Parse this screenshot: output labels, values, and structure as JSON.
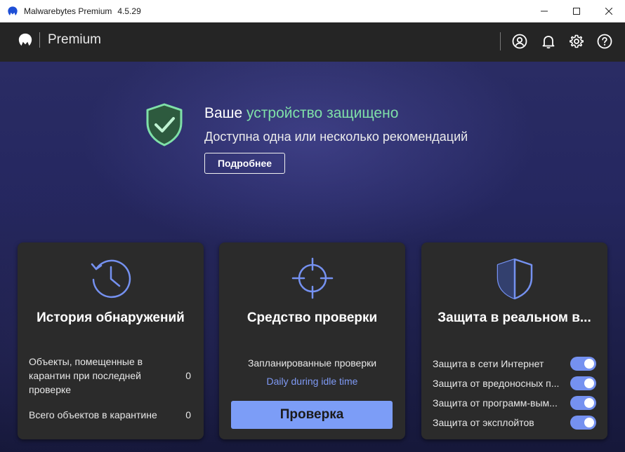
{
  "window": {
    "title": "Malwarebytes Premium",
    "version": "4.5.29"
  },
  "header": {
    "product": "Premium"
  },
  "status": {
    "prefix": "Ваше ",
    "highlight": "устройство защищено",
    "subtitle": "Доступна одна или несколько рекомендаций",
    "details_button": "Подробнее",
    "accent_color": "#7fe0a8"
  },
  "cards": {
    "history": {
      "title": "История обнаружений",
      "rows": [
        {
          "label": "Объекты, помещенные в карантин при последней проверке",
          "value": "0"
        },
        {
          "label": "Всего объектов в карантине",
          "value": "0"
        }
      ]
    },
    "scanner": {
      "title": "Средство проверки",
      "schedule_label": "Запланированные проверки",
      "schedule_value": "Daily during idle time",
      "scan_button": "Проверка"
    },
    "realtime": {
      "title": "Защита в реальном в...",
      "items": [
        {
          "label": "Защита в сети Интернет",
          "enabled": true
        },
        {
          "label": "Защита от вредоносных п...",
          "enabled": true
        },
        {
          "label": "Защита от программ-вым...",
          "enabled": true
        },
        {
          "label": "Защита от эксплойтов",
          "enabled": true
        }
      ]
    }
  },
  "colors": {
    "accent_blue": "#7c9df7",
    "icon_blue": "#7591f0",
    "card_bg": "#2b2b2b"
  },
  "icons": [
    "malwarebytes-logo",
    "account-icon",
    "bell-icon",
    "gear-icon",
    "help-icon",
    "shield-check-icon",
    "history-clock-icon",
    "crosshair-icon",
    "shield-icon"
  ]
}
